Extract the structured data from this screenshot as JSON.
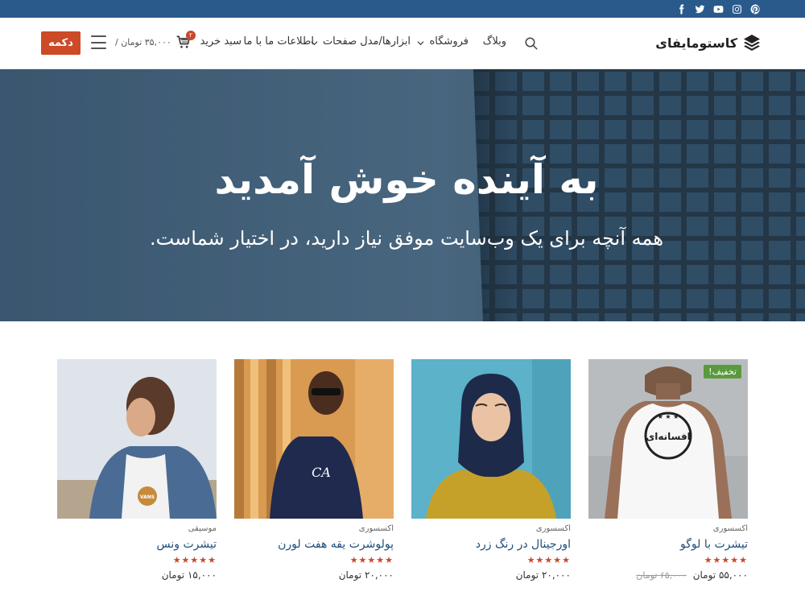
{
  "topbar": {
    "social_icons": [
      "pinterest-icon",
      "instagram-icon",
      "youtube-icon",
      "twitter-icon",
      "facebook-icon"
    ]
  },
  "header": {
    "logo_text": "کاستومایفای",
    "nav": {
      "blog": "وبلاگ",
      "shop": "فروشگاه",
      "tools": "ابزارها/مدل صفحات",
      "about": "اطلاعات ما با ما"
    },
    "cart_label": "سبد خرید",
    "cart_count": "۲",
    "cart_total": "۳۵,۰۰۰ تومان /",
    "cta_label": "دکمه"
  },
  "hero": {
    "title": "به آینده خوش آمدید",
    "subtitle": "همه آنچه برای یک وب‌سایت موفق نیاز دارید، در اختیار شماست."
  },
  "products": [
    {
      "category": "اکسسوری",
      "name": "تیشرت با لوگو",
      "rating": 5,
      "stars": "★★★★★",
      "old_price": "۶۵,۰۰۰ تومان",
      "price": "۵۵,۰۰۰ تومان",
      "badge": "تخفیف!",
      "shirt_text": "افسانه‌ای"
    },
    {
      "category": "اکسسوری",
      "name": "اورجینال در رنگ زرد",
      "rating": 5,
      "stars": "★★★★★",
      "price": "۲۰,۰۰۰ تومان"
    },
    {
      "category": "اکسسوری",
      "name": "پولوشرت یقه هفت لورن",
      "rating": 5,
      "stars": "★★★★★",
      "price": "۲۰,۰۰۰ تومان",
      "shirt_text": "CA"
    },
    {
      "category": "موسیقی",
      "name": "تیشرت ونس",
      "rating": 5,
      "stars": "★★★★★",
      "price": "۱۵,۰۰۰ تومان",
      "shirt_text": "VANS"
    }
  ],
  "colors": {
    "topbar": "#2a5a8c",
    "accent": "#cc4a26",
    "link": "#1e4d7b",
    "sale": "#5a9a3e",
    "stars": "#c9472c"
  }
}
